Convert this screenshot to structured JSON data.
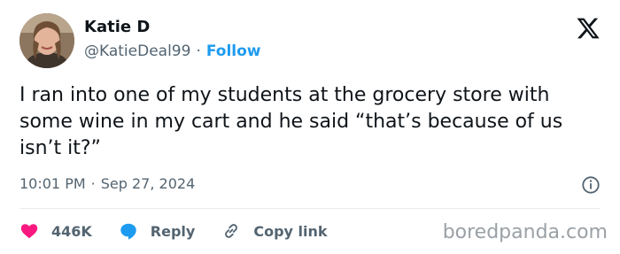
{
  "author": {
    "name": "Katie D",
    "handle": "@KatieDeal99",
    "separator": "·",
    "follow_label": "Follow"
  },
  "tweet": {
    "text": "I ran into one of my students at the grocery store with some wine in my cart and he said “that’s because of us isn’t it?”",
    "time": "10:01 PM",
    "separator": "·",
    "date": "Sep 27, 2024"
  },
  "actions": {
    "likes": "446K",
    "reply_label": "Reply",
    "copy_label": "Copy link"
  },
  "watermark": "boredpanda.com",
  "colors": {
    "like": "#f91880",
    "reply": "#1d9bf0",
    "follow": "#1d9bf0",
    "muted": "#536471"
  },
  "icons": [
    "x-logo-icon",
    "info-icon",
    "heart-icon",
    "reply-bubble-icon",
    "link-icon"
  ]
}
